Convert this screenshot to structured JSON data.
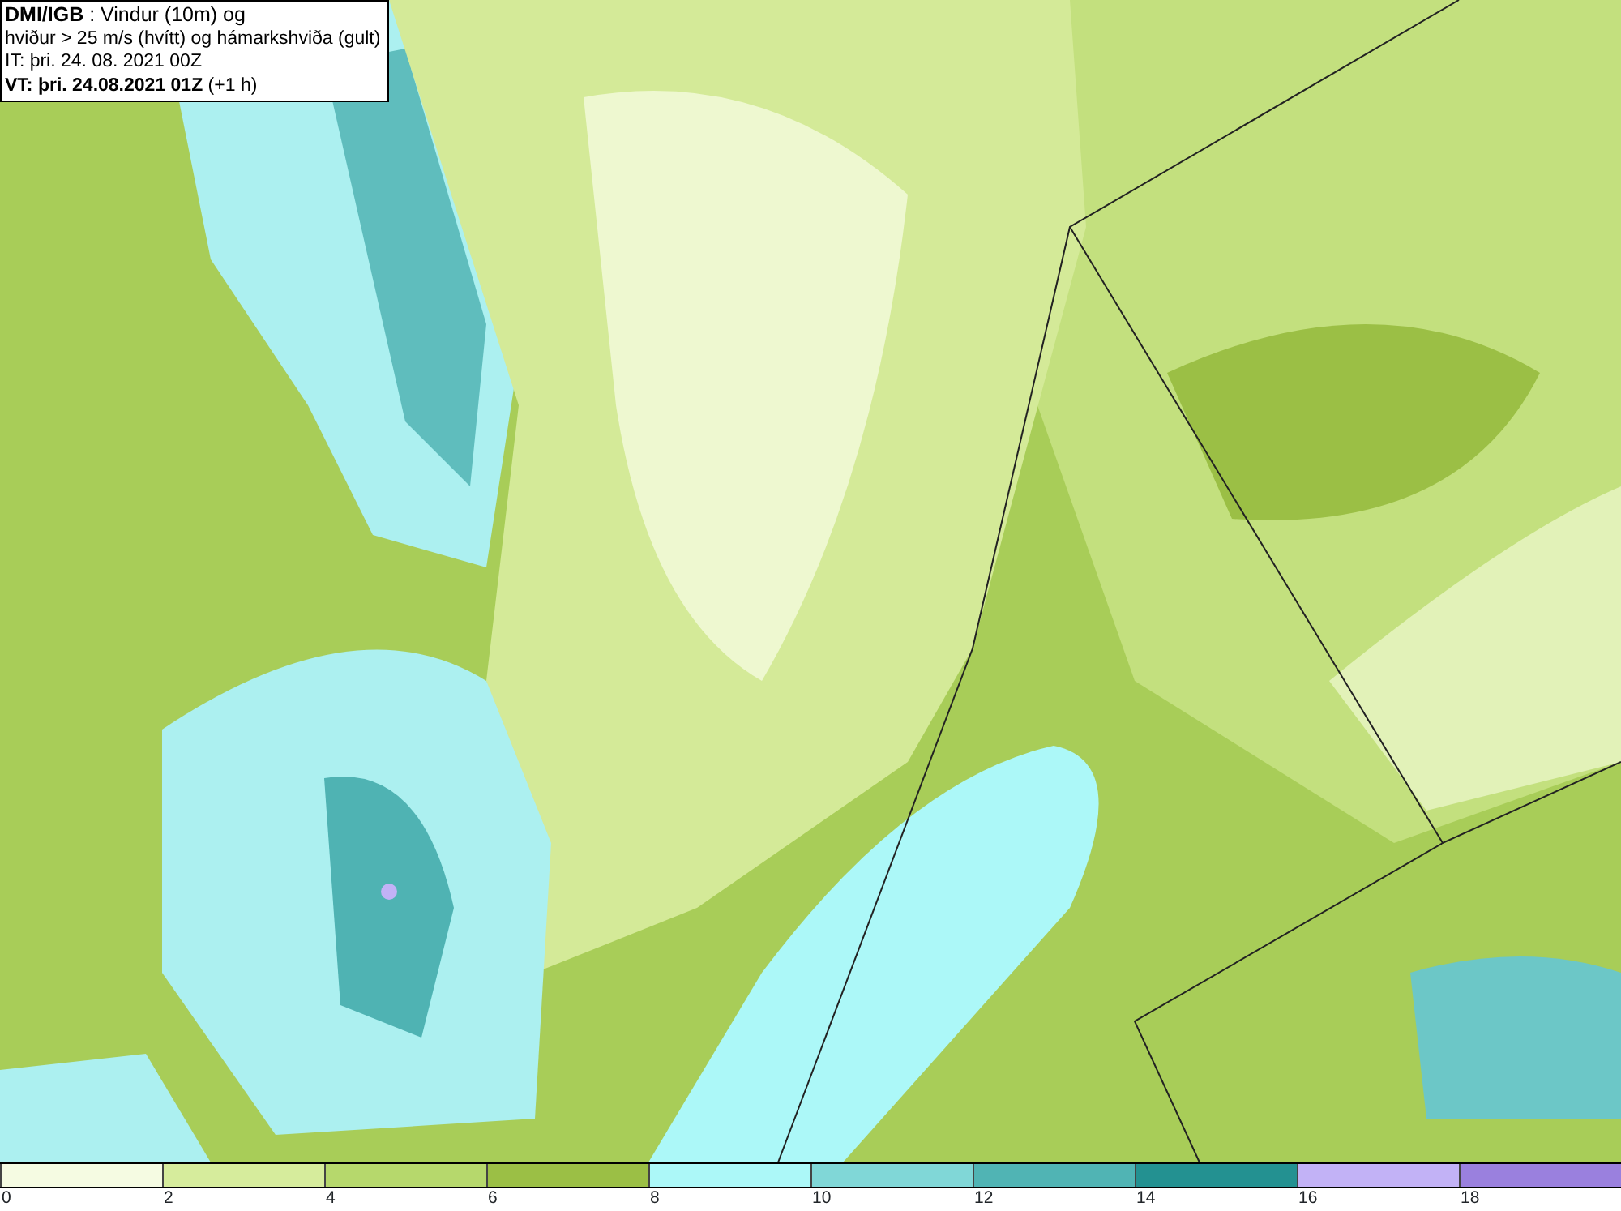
{
  "info_box": {
    "lines": [
      "**DMI/IGB** : Vindur (10m) og",
      "hviður > 25 m/s (hvítt) og hámarkshviða (gult)",
      "IT: þri. 24. 08. 2021 00Z",
      "**VT: þri. 24.08.2021 01Z** (+1 h)"
    ]
  },
  "legend": {
    "segments": [
      {
        "color": "#f5fbe2"
      },
      {
        "color": "#d6ec9c"
      },
      {
        "color": "#b6d86c"
      },
      {
        "color": "#9bbf45"
      },
      {
        "color": "#acf8f8"
      },
      {
        "color": "#80d7d7"
      },
      {
        "color": "#50b4b4"
      },
      {
        "color": "#239191"
      },
      {
        "color": "#c2b2f6"
      },
      {
        "color": "#9a80de"
      }
    ],
    "ticks": [
      "0",
      "2",
      "4",
      "6",
      "8",
      "10",
      "12",
      "14",
      "16",
      "18"
    ]
  }
}
